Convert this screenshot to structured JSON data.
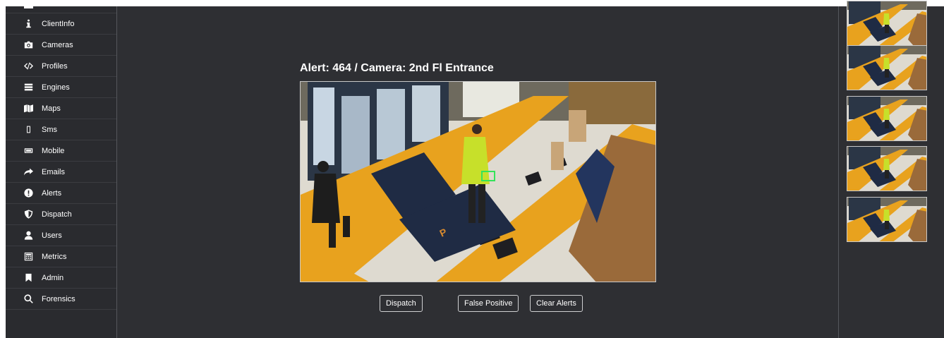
{
  "sidebar": {
    "items": [
      {
        "label": "ClientInfo",
        "icon": "info-icon"
      },
      {
        "label": "Cameras",
        "icon": "camera-icon"
      },
      {
        "label": "Profiles",
        "icon": "code-icon"
      },
      {
        "label": "Engines",
        "icon": "server-icon"
      },
      {
        "label": "Maps",
        "icon": "map-icon"
      },
      {
        "label": "Sms",
        "icon": "phone-icon"
      },
      {
        "label": "Mobile",
        "icon": "mobile-icon"
      },
      {
        "label": "Emails",
        "icon": "share-arrow-icon"
      },
      {
        "label": "Alerts",
        "icon": "exclamation-circle-icon"
      },
      {
        "label": "Dispatch",
        "icon": "shield-icon"
      },
      {
        "label": "Users",
        "icon": "user-icon"
      },
      {
        "label": "Metrics",
        "icon": "calculator-icon"
      },
      {
        "label": "Admin",
        "icon": "bookmark-icon"
      },
      {
        "label": "Forensics",
        "icon": "search-icon"
      }
    ]
  },
  "main": {
    "alert_title": "Alert: 464 / Camera: 2nd Fl Entrance",
    "feed_alt": "Camera feed",
    "buttons": {
      "dispatch": "Dispatch",
      "false_positive": "False Positive",
      "clear_alerts": "Clear Alerts"
    }
  },
  "thumbnails": {
    "count": 5
  },
  "colors": {
    "background": "#2e2f33",
    "sidebar": "#2a2b2f",
    "text": "#ffffff",
    "detection_box": "#35e35a",
    "floor_orange": "#e8a21e",
    "mat_navy": "#1f2b44"
  }
}
